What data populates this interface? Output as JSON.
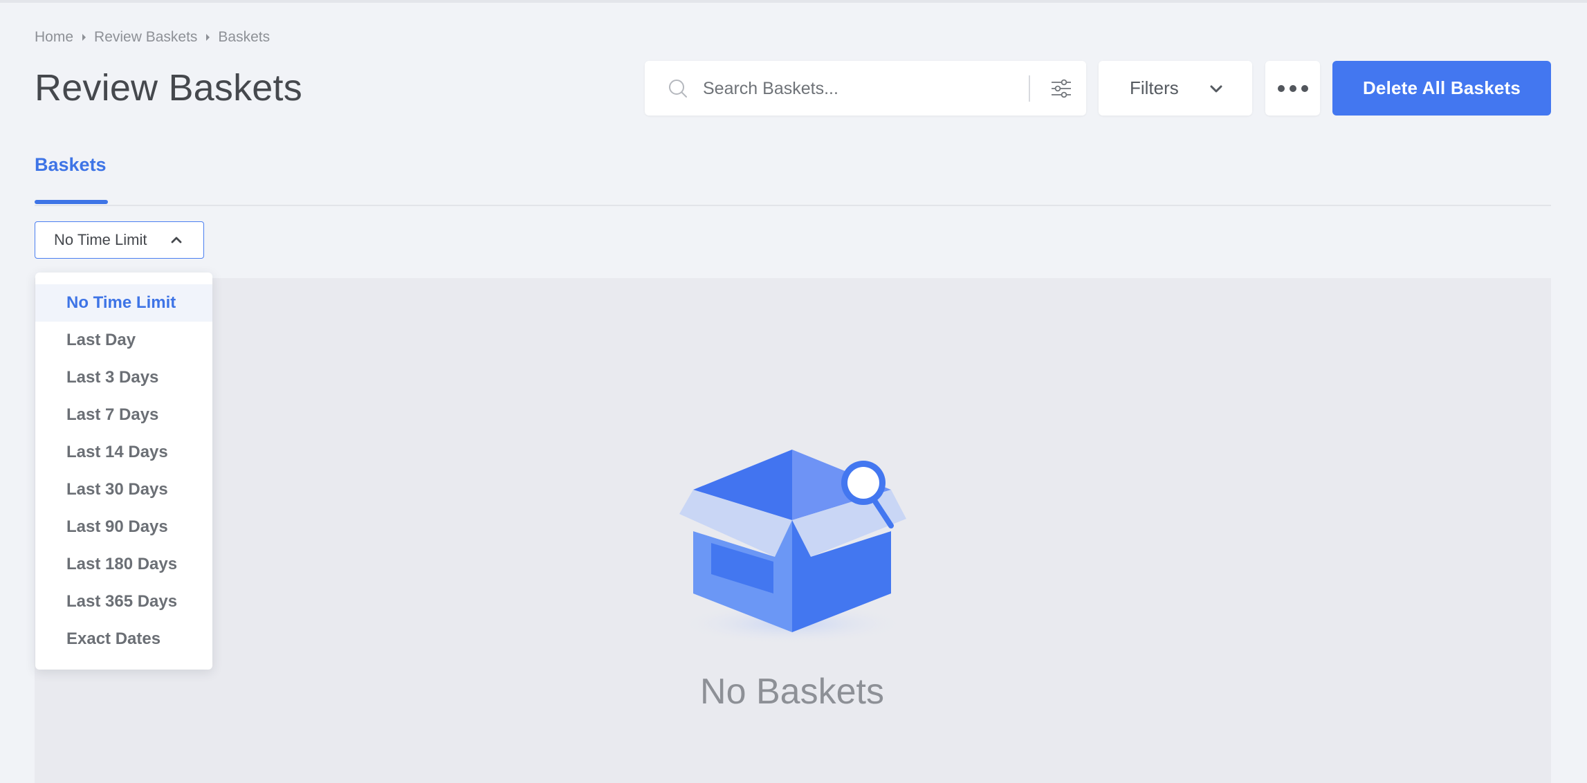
{
  "breadcrumb": {
    "items": [
      "Home",
      "Review Baskets",
      "Baskets"
    ]
  },
  "page": {
    "title": "Review Baskets"
  },
  "search": {
    "placeholder": "Search Baskets..."
  },
  "toolbar": {
    "filters_label": "Filters",
    "delete_label": "Delete All Baskets"
  },
  "tabs": [
    {
      "label": "Baskets",
      "active": true
    }
  ],
  "time_filter": {
    "selected": "No Time Limit",
    "options": [
      "No Time Limit",
      "Last Day",
      "Last 3 Days",
      "Last 7 Days",
      "Last 14 Days",
      "Last 30 Days",
      "Last 90 Days",
      "Last 180 Days",
      "Last 365 Days",
      "Exact Dates"
    ]
  },
  "empty_state": {
    "message": "No Baskets"
  },
  "colors": {
    "accent": "#4377f0",
    "background": "#f1f3f7",
    "content_bg": "#e9eaef",
    "muted_text": "#8d9096"
  },
  "icons": {
    "search": "search-icon",
    "tune": "tune-icon",
    "filters_chevron": "chevron-down-icon",
    "more": "more-horizontal-icon",
    "select_chevron": "chevron-up-icon",
    "breadcrumb_sep": "chevron-right-icon",
    "empty": "open-box-search-icon"
  }
}
